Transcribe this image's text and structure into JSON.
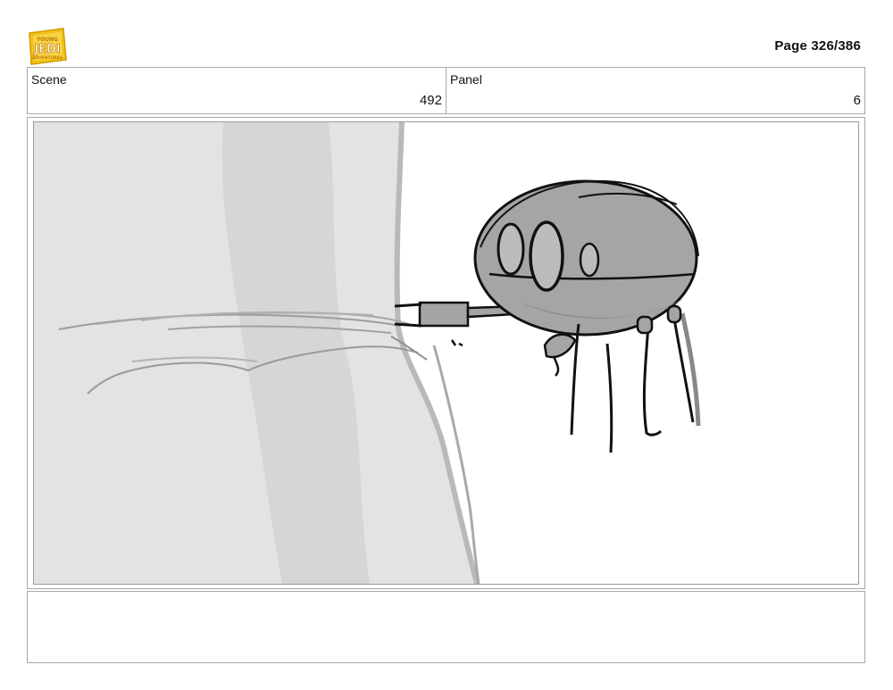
{
  "header": {
    "logo_text": "YOUNG JEDI ADVENTURES",
    "page_label": "Page 326/386"
  },
  "info": {
    "scene_label": "Scene",
    "scene_value": "492",
    "panel_label": "Panel",
    "panel_value": "6"
  },
  "sketch": {
    "subject": "droid-sketch"
  },
  "notes": {
    "text": ""
  }
}
